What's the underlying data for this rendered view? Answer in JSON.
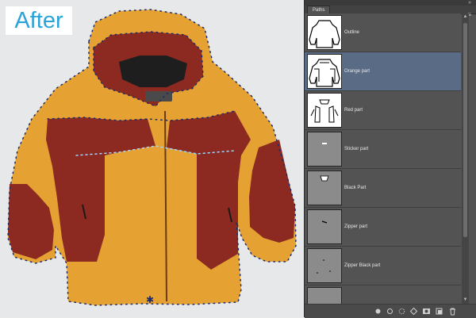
{
  "canvas": {
    "badge_label": "After",
    "badge_color": "#2aa3d8",
    "subject": "hooded jacket with orange and red clipping paths drawn over it"
  },
  "colors": {
    "orange": "#e5a233",
    "red": "#8c2a22",
    "path_anchor": "#1b2a6b",
    "panel_bg": "#535353",
    "selected_row": "#5a6b85"
  },
  "paths_panel": {
    "tab_label": "Paths",
    "collapse_icon": "double-chevron-icon",
    "menu_icon": "panel-menu-icon",
    "rows": [
      {
        "label": "Outline",
        "selected": false
      },
      {
        "label": "Orange part",
        "selected": true
      },
      {
        "label": "Red part",
        "selected": false
      },
      {
        "label": "Sticker part",
        "selected": false
      },
      {
        "label": "Black Part",
        "selected": false
      },
      {
        "label": "Zipper part",
        "selected": false
      },
      {
        "label": "Zipper Black part",
        "selected": false
      },
      {
        "label": "",
        "selected": false
      }
    ],
    "bottom_icons": [
      "fill-path-icon",
      "stroke-path-icon",
      "load-as-selection-icon",
      "make-work-path-icon",
      "add-mask-icon",
      "new-path-icon",
      "trash-icon"
    ]
  }
}
